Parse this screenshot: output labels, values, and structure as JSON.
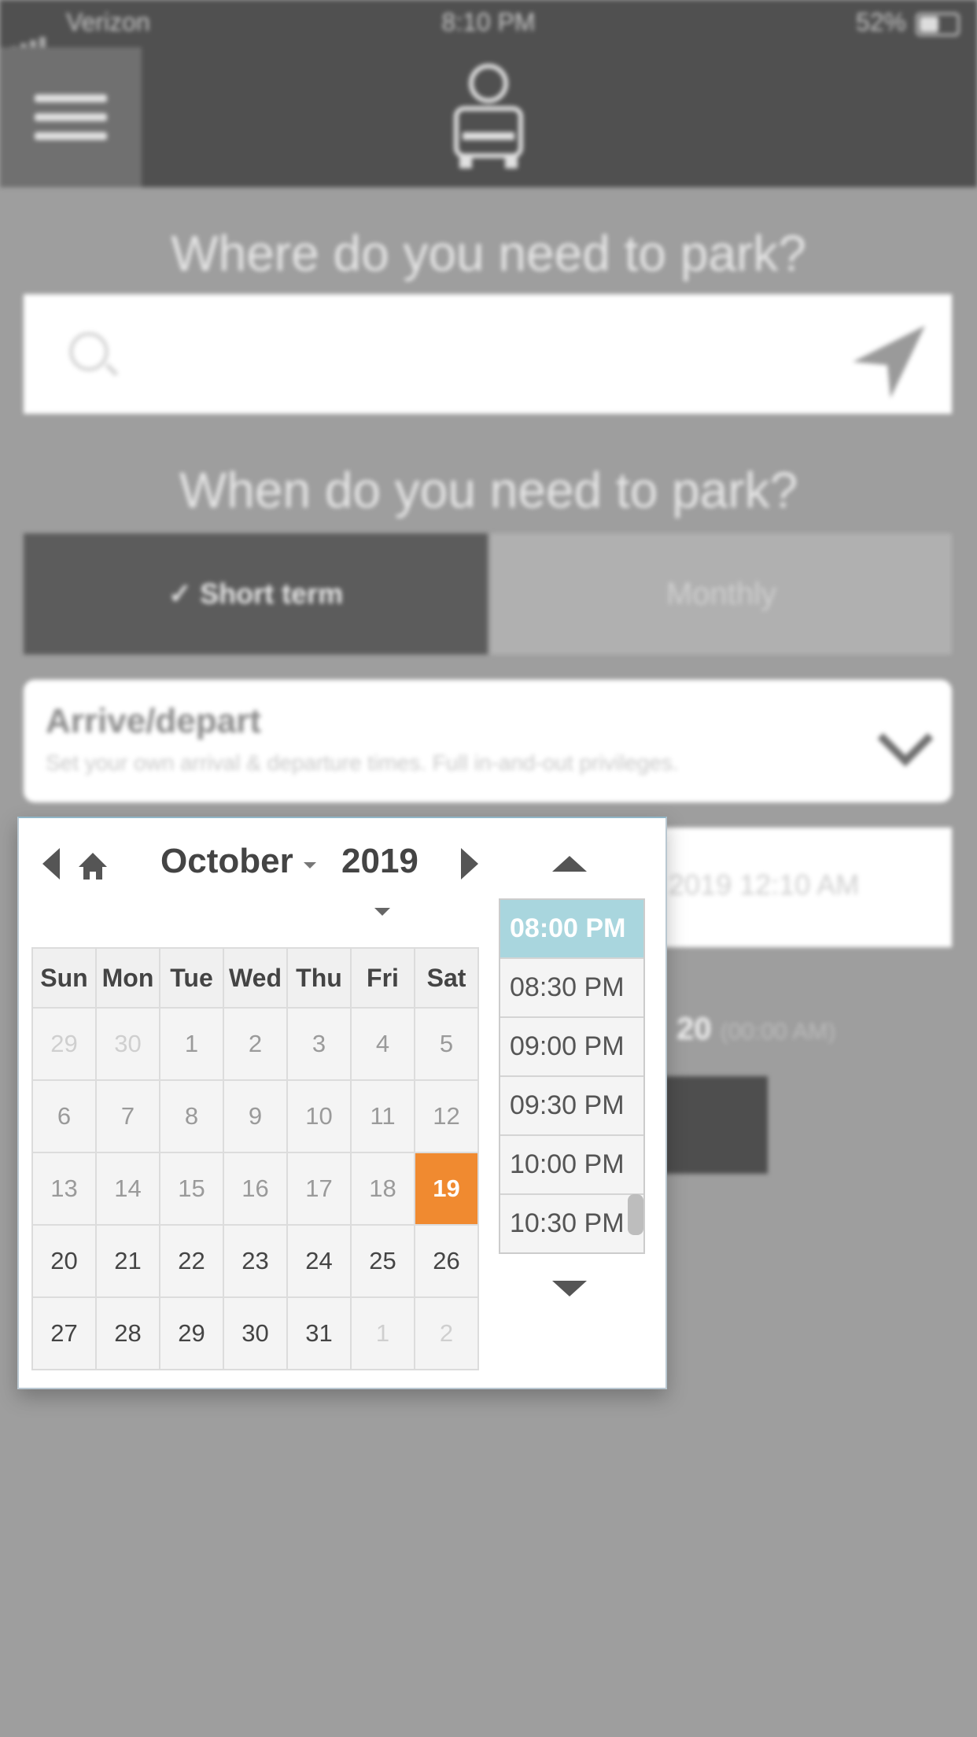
{
  "status_bar": {
    "carrier": "Verizon",
    "time": "8:10 PM",
    "battery": "52%"
  },
  "header": {
    "menu_icon": "hamburger-menu-icon",
    "logo_icon": "parking-car-logo-icon"
  },
  "search": {
    "heading": "Where do you need to park?",
    "placeholder": "",
    "search_icon": "search-icon",
    "locate_icon": "navigation-arrow-icon"
  },
  "when": {
    "heading": "When do you need to park?"
  },
  "segments": {
    "short_term": "✓ Short term",
    "monthly": "Monthly"
  },
  "arrive": {
    "title": "Arrive/depart",
    "description": "Set your own arrival & departure times. Full in-and-out privileges."
  },
  "date_field": {
    "value": "2019 12:10 AM"
  },
  "note": {
    "bold": "20",
    "time": "(00:00 AM)"
  },
  "picker": {
    "month": "October",
    "year": "2019",
    "weekdays": [
      "Sun",
      "Mon",
      "Tue",
      "Wed",
      "Thu",
      "Fri",
      "Sat"
    ],
    "weeks": [
      [
        {
          "d": "29",
          "s": "other"
        },
        {
          "d": "30",
          "s": "other"
        },
        {
          "d": "1",
          "s": "past"
        },
        {
          "d": "2",
          "s": "past"
        },
        {
          "d": "3",
          "s": "past"
        },
        {
          "d": "4",
          "s": "past"
        },
        {
          "d": "5",
          "s": "past"
        }
      ],
      [
        {
          "d": "6",
          "s": "past"
        },
        {
          "d": "7",
          "s": "past"
        },
        {
          "d": "8",
          "s": "past"
        },
        {
          "d": "9",
          "s": "past"
        },
        {
          "d": "10",
          "s": "past"
        },
        {
          "d": "11",
          "s": "past"
        },
        {
          "d": "12",
          "s": "past"
        }
      ],
      [
        {
          "d": "13",
          "s": "past"
        },
        {
          "d": "14",
          "s": "past"
        },
        {
          "d": "15",
          "s": "past"
        },
        {
          "d": "16",
          "s": "past"
        },
        {
          "d": "17",
          "s": "past"
        },
        {
          "d": "18",
          "s": "past"
        },
        {
          "d": "19",
          "s": "sel"
        }
      ],
      [
        {
          "d": "20",
          "s": "cur"
        },
        {
          "d": "21",
          "s": "cur"
        },
        {
          "d": "22",
          "s": "cur"
        },
        {
          "d": "23",
          "s": "cur"
        },
        {
          "d": "24",
          "s": "cur"
        },
        {
          "d": "25",
          "s": "cur"
        },
        {
          "d": "26",
          "s": "cur"
        }
      ],
      [
        {
          "d": "27",
          "s": "cur"
        },
        {
          "d": "28",
          "s": "cur"
        },
        {
          "d": "29",
          "s": "cur"
        },
        {
          "d": "30",
          "s": "cur"
        },
        {
          "d": "31",
          "s": "cur"
        },
        {
          "d": "1",
          "s": "other"
        },
        {
          "d": "2",
          "s": "other"
        }
      ]
    ],
    "times": [
      "08:00 PM",
      "08:30 PM",
      "09:00 PM",
      "09:30 PM",
      "10:00 PM",
      "10:30 PM"
    ],
    "selected_time": "08:00 PM",
    "colors": {
      "selected_day": "#f08a30",
      "selected_time": "#a9d6de"
    }
  }
}
